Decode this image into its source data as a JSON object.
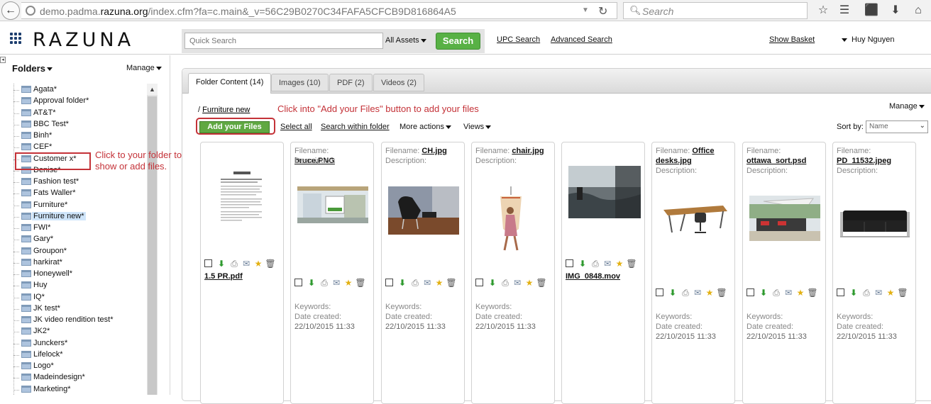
{
  "browser": {
    "url_prefix": "demo.padma.",
    "url_domain": "razuna.org",
    "url_suffix": "/index.cfm?fa=c.main&_v=56C29B0270C34FAFA5CFCB9D816864A5",
    "search_placeholder": "Search"
  },
  "header": {
    "logo_text": "RAZUNA",
    "quick_search_placeholder": "Quick Search",
    "asset_filter": "All Assets",
    "search_button": "Search",
    "upc_search": "UPC Search",
    "advanced_search": "Advanced Search",
    "show_basket": "Show Basket",
    "user_name": "Huy Nguyen"
  },
  "sidebar": {
    "title": "Folders",
    "manage": "Manage",
    "folders": [
      "Agata*",
      "Approval folder*",
      "AT&T*",
      "BBC Test*",
      "Binh*",
      "CEF*",
      "Customer x*",
      "Denise*",
      "Fashion test*",
      "Fats Waller*",
      "Furniture*",
      "Furniture new*",
      "FWI*",
      "Gary*",
      "Groupon*",
      "harkirat*",
      "Honeywell*",
      "Huy",
      "IQ*",
      "JK test*",
      "JK video rendition test*",
      "JK2*",
      "Junckers*",
      "Lifelock*",
      "Logo*",
      "Madeindesign*",
      "Marketing*"
    ],
    "selected_folder": "Furniture new*",
    "callout": "Click to your folder to show or add files."
  },
  "content": {
    "tabs": [
      "Folder Content (14)",
      "Images (10)",
      "PDF (2)",
      "Videos (2)"
    ],
    "breadcrumb_sep": "/",
    "breadcrumb": "Furniture new",
    "add_files_callout": "Click into \"Add your Files\" button to add your files",
    "add_files_button": "Add your Files",
    "select_all": "Select all",
    "search_within_folder": "Search within folder",
    "more_actions": "More actions",
    "views": "Views",
    "manage": "Manage",
    "sort_label": "Sort by:",
    "sort_value": "Name"
  },
  "labels": {
    "filename": "Filename:",
    "description": "Description:",
    "keywords": "Keywords:",
    "date_created": "Date created:"
  },
  "icons": [
    "download-icon",
    "print-icon",
    "email-icon",
    "favorite-star-icon",
    "trash-icon"
  ],
  "cards": [
    {
      "type": "pdf",
      "name": "1.5 PR.pdf"
    },
    {
      "type": "image",
      "name": "bruce.PNG",
      "date": "22/10/2015 11:33"
    },
    {
      "type": "image",
      "name": "CH.jpg",
      "date": "22/10/2015 11:33"
    },
    {
      "type": "image",
      "name": "chair.jpg",
      "date": "22/10/2015 11:33"
    },
    {
      "type": "video",
      "name": "IMG_0848.mov"
    },
    {
      "type": "image",
      "name_line1": "Office",
      "name_line2": "desks.jpg",
      "date": "22/10/2015 11:33"
    },
    {
      "type": "image",
      "name": "ottawa_sort.psd",
      "date": "22/10/2015 11:33"
    },
    {
      "type": "image",
      "name": "PD_11532.jpeg",
      "date": "22/10/2015 11:33"
    }
  ],
  "colors": {
    "accent_green": "#58b145",
    "annotation_red": "#c43238",
    "logo_blue": "#1d3e6e"
  }
}
